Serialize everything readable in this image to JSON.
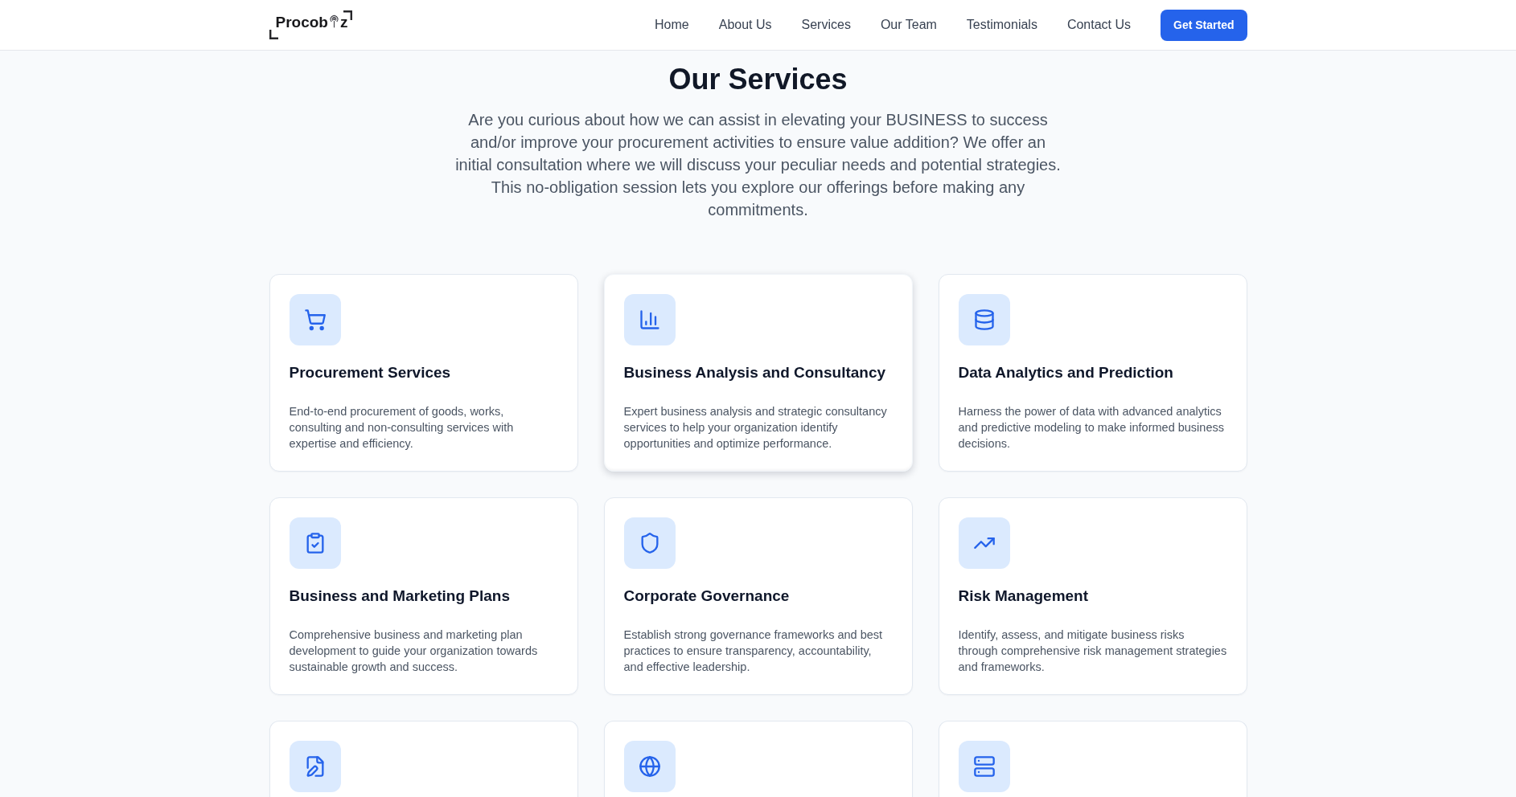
{
  "header": {
    "logo": {
      "lead": "Procob",
      "tail": "z"
    },
    "nav": [
      {
        "label": "Home"
      },
      {
        "label": "About Us"
      },
      {
        "label": "Services"
      },
      {
        "label": "Our Team"
      },
      {
        "label": "Testimonials"
      },
      {
        "label": "Contact Us"
      }
    ],
    "cta": "Get Started"
  },
  "services": {
    "title": "Our Services",
    "intro": "Are you curious about how we can assist in elevating your BUSINESS to success and/or improve your procurement activities to ensure value addition? We offer an initial consultation where we will discuss your peculiar needs and potential strategies. This no-obligation session lets you explore our offerings before making any commitments.",
    "cards": [
      {
        "title": "Procurement Services",
        "description": "End-to-end procurement of goods, works, consulting and non-consulting services with expertise and efficiency.",
        "highlighted": false
      },
      {
        "title": "Business Analysis and Consultancy",
        "description": "Expert business analysis and strategic consultancy services to help your organization identify opportunities and optimize performance.",
        "highlighted": true
      },
      {
        "title": "Data Analytics and Prediction",
        "description": "Harness the power of data with advanced analytics and predictive modeling to make informed business decisions.",
        "highlighted": false
      },
      {
        "title": "Business and Marketing Plans",
        "description": "Comprehensive business and marketing plan development to guide your organization towards sustainable growth and success.",
        "highlighted": false
      },
      {
        "title": "Corporate Governance",
        "description": "Establish strong governance frameworks and best practices to ensure transparency, accountability, and effective leadership.",
        "highlighted": false
      },
      {
        "title": "Risk Management",
        "description": "Identify, assess, and mitigate business risks through comprehensive risk management strategies and frameworks.",
        "highlighted": false
      },
      {
        "highlighted": false
      },
      {
        "highlighted": false
      },
      {
        "highlighted": false
      }
    ]
  }
}
